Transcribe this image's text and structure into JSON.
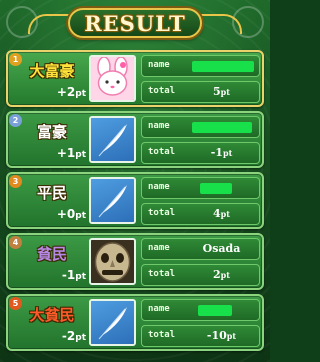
{
  "header": {
    "title": "RESULT"
  },
  "players": [
    {
      "rank": "1",
      "title": "大富豪",
      "points": "+2",
      "unit": "pt",
      "name": "",
      "total_label": "total",
      "name_label": "name",
      "total": "5",
      "avatar": "pink-bunny-icon",
      "title_color": "#ffe23a",
      "badge_color": "#e0a020"
    },
    {
      "rank": "2",
      "title": "富豪",
      "points": "+1",
      "unit": "pt",
      "name": "",
      "total_label": "total",
      "name_label": "name",
      "total": "-1",
      "avatar": "white-quill-icon",
      "title_color": "#ffffff",
      "badge_color": "#7aa0d8"
    },
    {
      "rank": "3",
      "title": "平民",
      "points": "+0",
      "unit": "pt",
      "name": "",
      "total_label": "total",
      "name_label": "name",
      "total": "4",
      "avatar": "white-quill-icon",
      "title_color": "#ffffff",
      "badge_color": "#e08a20"
    },
    {
      "rank": "4",
      "title": "貧民",
      "points": "-1",
      "unit": "pt",
      "name": "Osada",
      "total_label": "total",
      "name_label": "name",
      "total": "2",
      "avatar": "stone-mask-icon",
      "title_color": "#b888e8",
      "badge_color": "#c08040"
    },
    {
      "rank": "5",
      "title": "大貧民",
      "points": "-2",
      "unit": "pt",
      "name": "",
      "total_label": "total",
      "name_label": "name",
      "total": "-10",
      "avatar": "white-quill-icon",
      "title_color": "#ff5a2a",
      "badge_color": "#e05a20"
    }
  ]
}
